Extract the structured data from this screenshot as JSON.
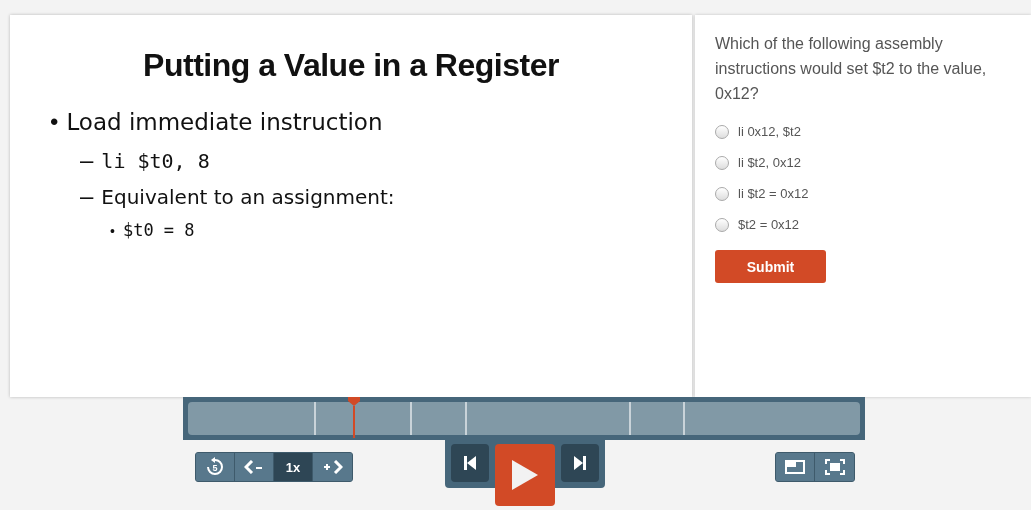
{
  "slide": {
    "title": "Putting a Value in a Register",
    "bullets": [
      {
        "marker": "•",
        "text": "Load immediate instruction",
        "kind": "text",
        "children": [
          {
            "marker": "–",
            "text": "li $t0, 8",
            "kind": "code"
          },
          {
            "marker": "–",
            "text": "Equivalent to an assignment:",
            "kind": "text",
            "children": [
              {
                "marker": "•",
                "text": "$t0 = 8",
                "kind": "code"
              }
            ]
          }
        ]
      }
    ]
  },
  "quiz": {
    "question": "Which of the following assembly instructions would set $t2 to the value, 0x12?",
    "options": [
      {
        "label": "li 0x12, $t2",
        "selected": false
      },
      {
        "label": "li $t2, 0x12",
        "selected": false
      },
      {
        "label": "li $t2 = 0x12",
        "selected": false
      },
      {
        "label": "$t2 = 0x12",
        "selected": false
      }
    ],
    "submit": "Submit"
  },
  "player": {
    "playhead": {
      "level": 0.25
    },
    "replay_seconds": "5",
    "speed": "1x"
  }
}
